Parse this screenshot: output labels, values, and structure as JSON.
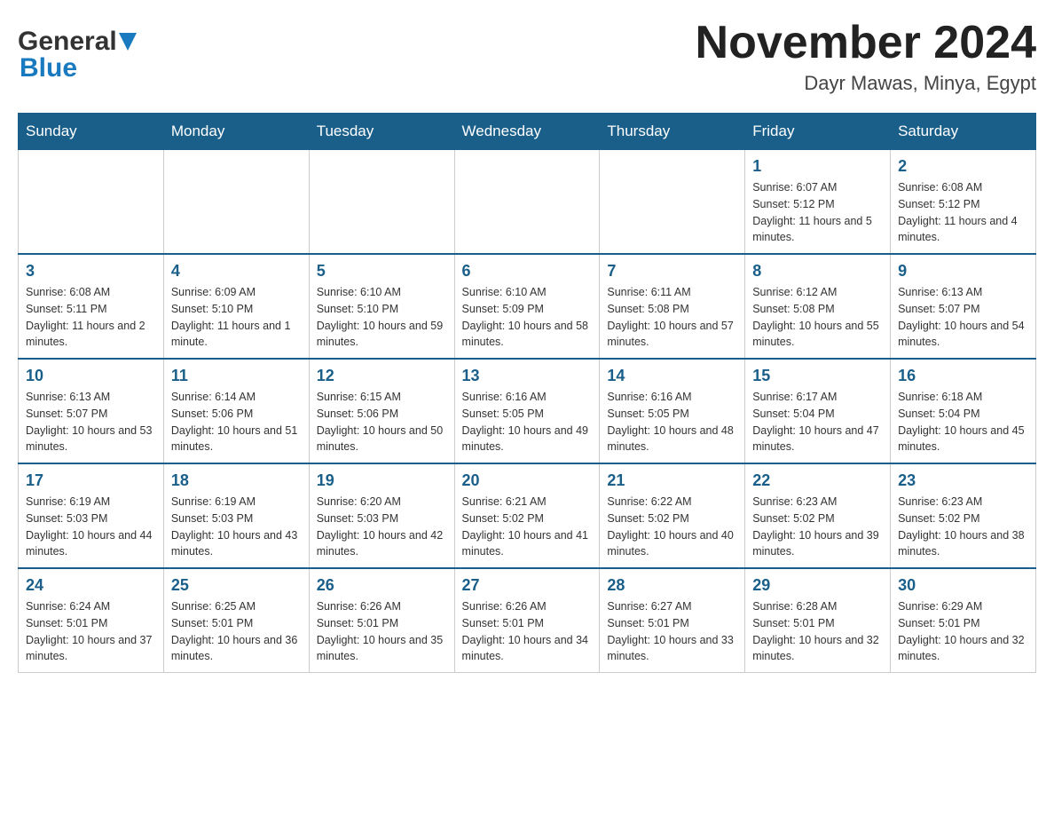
{
  "header": {
    "logo_main": "General",
    "logo_sub": "Blue",
    "month_year": "November 2024",
    "location": "Dayr Mawas, Minya, Egypt"
  },
  "days_of_week": [
    "Sunday",
    "Monday",
    "Tuesday",
    "Wednesday",
    "Thursday",
    "Friday",
    "Saturday"
  ],
  "weeks": [
    [
      {
        "day": "",
        "info": ""
      },
      {
        "day": "",
        "info": ""
      },
      {
        "day": "",
        "info": ""
      },
      {
        "day": "",
        "info": ""
      },
      {
        "day": "",
        "info": ""
      },
      {
        "day": "1",
        "info": "Sunrise: 6:07 AM\nSunset: 5:12 PM\nDaylight: 11 hours and 5 minutes."
      },
      {
        "day": "2",
        "info": "Sunrise: 6:08 AM\nSunset: 5:12 PM\nDaylight: 11 hours and 4 minutes."
      }
    ],
    [
      {
        "day": "3",
        "info": "Sunrise: 6:08 AM\nSunset: 5:11 PM\nDaylight: 11 hours and 2 minutes."
      },
      {
        "day": "4",
        "info": "Sunrise: 6:09 AM\nSunset: 5:10 PM\nDaylight: 11 hours and 1 minute."
      },
      {
        "day": "5",
        "info": "Sunrise: 6:10 AM\nSunset: 5:10 PM\nDaylight: 10 hours and 59 minutes."
      },
      {
        "day": "6",
        "info": "Sunrise: 6:10 AM\nSunset: 5:09 PM\nDaylight: 10 hours and 58 minutes."
      },
      {
        "day": "7",
        "info": "Sunrise: 6:11 AM\nSunset: 5:08 PM\nDaylight: 10 hours and 57 minutes."
      },
      {
        "day": "8",
        "info": "Sunrise: 6:12 AM\nSunset: 5:08 PM\nDaylight: 10 hours and 55 minutes."
      },
      {
        "day": "9",
        "info": "Sunrise: 6:13 AM\nSunset: 5:07 PM\nDaylight: 10 hours and 54 minutes."
      }
    ],
    [
      {
        "day": "10",
        "info": "Sunrise: 6:13 AM\nSunset: 5:07 PM\nDaylight: 10 hours and 53 minutes."
      },
      {
        "day": "11",
        "info": "Sunrise: 6:14 AM\nSunset: 5:06 PM\nDaylight: 10 hours and 51 minutes."
      },
      {
        "day": "12",
        "info": "Sunrise: 6:15 AM\nSunset: 5:06 PM\nDaylight: 10 hours and 50 minutes."
      },
      {
        "day": "13",
        "info": "Sunrise: 6:16 AM\nSunset: 5:05 PM\nDaylight: 10 hours and 49 minutes."
      },
      {
        "day": "14",
        "info": "Sunrise: 6:16 AM\nSunset: 5:05 PM\nDaylight: 10 hours and 48 minutes."
      },
      {
        "day": "15",
        "info": "Sunrise: 6:17 AM\nSunset: 5:04 PM\nDaylight: 10 hours and 47 minutes."
      },
      {
        "day": "16",
        "info": "Sunrise: 6:18 AM\nSunset: 5:04 PM\nDaylight: 10 hours and 45 minutes."
      }
    ],
    [
      {
        "day": "17",
        "info": "Sunrise: 6:19 AM\nSunset: 5:03 PM\nDaylight: 10 hours and 44 minutes."
      },
      {
        "day": "18",
        "info": "Sunrise: 6:19 AM\nSunset: 5:03 PM\nDaylight: 10 hours and 43 minutes."
      },
      {
        "day": "19",
        "info": "Sunrise: 6:20 AM\nSunset: 5:03 PM\nDaylight: 10 hours and 42 minutes."
      },
      {
        "day": "20",
        "info": "Sunrise: 6:21 AM\nSunset: 5:02 PM\nDaylight: 10 hours and 41 minutes."
      },
      {
        "day": "21",
        "info": "Sunrise: 6:22 AM\nSunset: 5:02 PM\nDaylight: 10 hours and 40 minutes."
      },
      {
        "day": "22",
        "info": "Sunrise: 6:23 AM\nSunset: 5:02 PM\nDaylight: 10 hours and 39 minutes."
      },
      {
        "day": "23",
        "info": "Sunrise: 6:23 AM\nSunset: 5:02 PM\nDaylight: 10 hours and 38 minutes."
      }
    ],
    [
      {
        "day": "24",
        "info": "Sunrise: 6:24 AM\nSunset: 5:01 PM\nDaylight: 10 hours and 37 minutes."
      },
      {
        "day": "25",
        "info": "Sunrise: 6:25 AM\nSunset: 5:01 PM\nDaylight: 10 hours and 36 minutes."
      },
      {
        "day": "26",
        "info": "Sunrise: 6:26 AM\nSunset: 5:01 PM\nDaylight: 10 hours and 35 minutes."
      },
      {
        "day": "27",
        "info": "Sunrise: 6:26 AM\nSunset: 5:01 PM\nDaylight: 10 hours and 34 minutes."
      },
      {
        "day": "28",
        "info": "Sunrise: 6:27 AM\nSunset: 5:01 PM\nDaylight: 10 hours and 33 minutes."
      },
      {
        "day": "29",
        "info": "Sunrise: 6:28 AM\nSunset: 5:01 PM\nDaylight: 10 hours and 32 minutes."
      },
      {
        "day": "30",
        "info": "Sunrise: 6:29 AM\nSunset: 5:01 PM\nDaylight: 10 hours and 32 minutes."
      }
    ]
  ]
}
